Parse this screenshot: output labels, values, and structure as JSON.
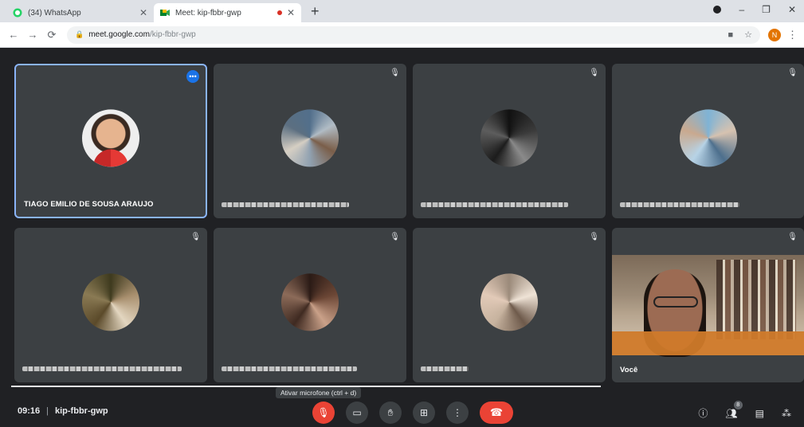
{
  "browser": {
    "tabs": [
      {
        "label": "(34) WhatsApp",
        "icon": "whatsapp-icon",
        "active": false
      },
      {
        "label": "Meet: kip-fbbr-gwp",
        "icon": "meet-icon",
        "active": true
      }
    ],
    "new_tab": "+",
    "url_host": "meet.google.com",
    "url_path": "/kip-fbbr-gwp",
    "profile_initial": "N"
  },
  "participants": [
    {
      "name": "TIAGO EMILIO DE SOUSA ARAUJO",
      "avatar": "photo",
      "pinned_menu": "•••"
    },
    {
      "name": "",
      "avatar": "pix1"
    },
    {
      "name": "",
      "avatar": "pix2"
    },
    {
      "name": "",
      "avatar": "pix3"
    },
    {
      "name": "",
      "avatar": "pix4"
    },
    {
      "name": "",
      "avatar": "pix5"
    },
    {
      "name": "",
      "avatar": "pix6"
    },
    {
      "name": "Você",
      "avatar": "video"
    }
  ],
  "toolbar": {
    "time": "09:16",
    "meeting_code": "kip-fbbr-gwp",
    "tooltip": "Ativar microfone (ctrl + d)",
    "people_count": "8"
  },
  "colors": {
    "background": "#202124",
    "tile": "#3c4043",
    "accent": "#1a73e8",
    "danger": "#ea4335"
  }
}
